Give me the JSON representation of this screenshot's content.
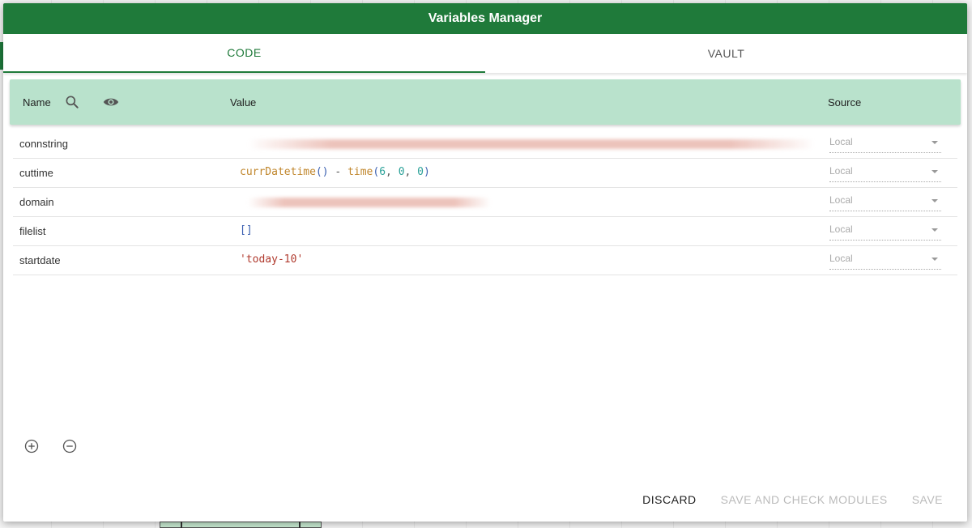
{
  "dialog": {
    "title": "Variables Manager"
  },
  "tabs": [
    {
      "label": "CODE",
      "active": true
    },
    {
      "label": "VAULT",
      "active": false
    }
  ],
  "table": {
    "headers": {
      "name": "Name",
      "value": "Value",
      "source": "Source"
    },
    "rows": [
      {
        "name": "connstring",
        "value_redacted": true,
        "source": "Local"
      },
      {
        "name": "cuttime",
        "value": "currDatetime() - time(6, 0, 0)",
        "source": "Local"
      },
      {
        "name": "domain",
        "value_redacted": true,
        "source": "Local"
      },
      {
        "name": "filelist",
        "value": "[]",
        "source": "Local"
      },
      {
        "name": "startdate",
        "value": "'today-10'",
        "source": "Local"
      }
    ]
  },
  "actions": {
    "discard": "DISCARD",
    "save_check": "SAVE AND CHECK MODULES",
    "save": "SAVE"
  },
  "colors": {
    "header": "#1f7a3a",
    "table_header": "#b9e2cc"
  },
  "icons": [
    "search-icon",
    "eye-icon",
    "add-circle-icon",
    "remove-circle-icon",
    "dropdown-caret-icon"
  ]
}
